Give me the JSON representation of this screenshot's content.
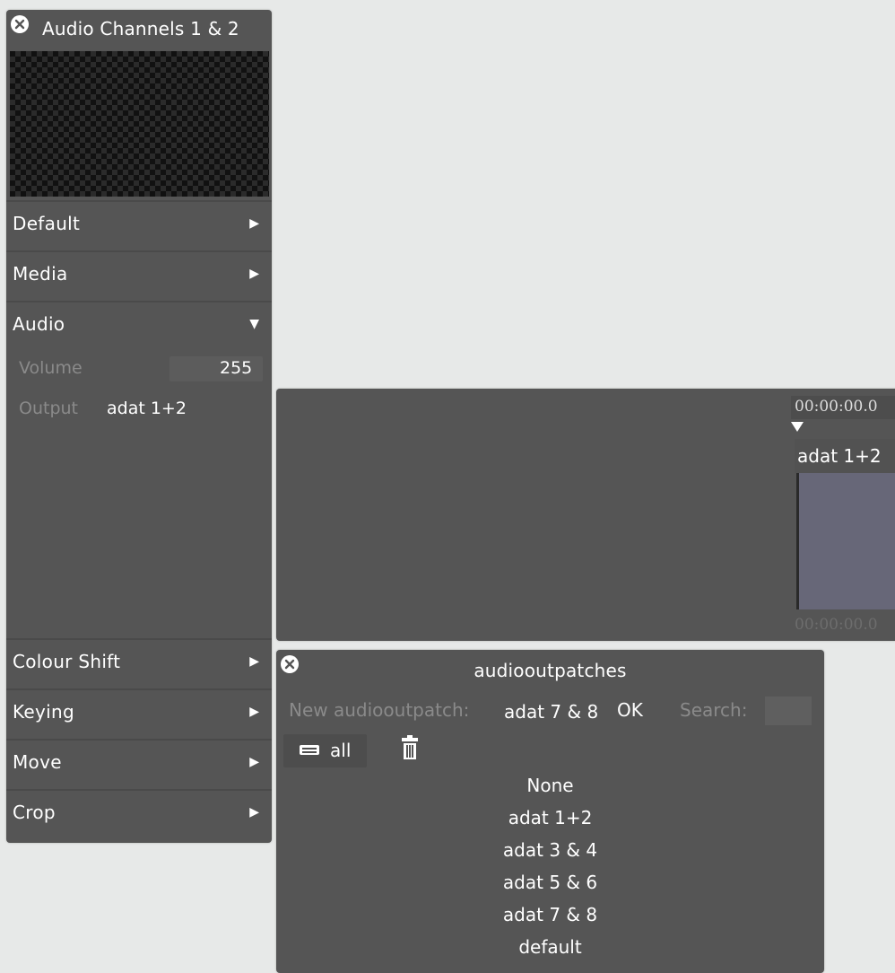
{
  "inspector": {
    "title": "Audio Channels 1 & 2",
    "sections": {
      "default": {
        "label": "Default",
        "arrow": "▶"
      },
      "media": {
        "label": "Media",
        "arrow": "▶"
      },
      "audio": {
        "label": "Audio",
        "arrow": "▼"
      },
      "colour_shift": {
        "label": "Colour Shift",
        "arrow": "▶"
      },
      "keying": {
        "label": "Keying",
        "arrow": "▶"
      },
      "move": {
        "label": "Move",
        "arrow": "▶"
      },
      "crop": {
        "label": "Crop",
        "arrow": "▶"
      }
    },
    "audio": {
      "volume_label": "Volume",
      "volume_value": "255",
      "output_label": "Output",
      "output_value": "adat 1+2"
    }
  },
  "timeline": {
    "start_time": "00:00:00.0",
    "end_time": "00:00:00.0",
    "clip_label": "adat 1+2"
  },
  "patches": {
    "title": "audiooutpatches",
    "new_label": "New audiooutpatch:",
    "new_value": "adat 7 & 8",
    "ok_label": "OK",
    "search_label": "Search:",
    "search_value": "",
    "all_label": "all",
    "items": [
      "None",
      "adat 1+2",
      "adat 3 & 4",
      "adat 5 & 6",
      "adat 7 & 8",
      "default"
    ]
  },
  "colors": {
    "panel_bg": "#555555",
    "page_bg": "#e7e9e8",
    "clip_body": "#676778"
  }
}
